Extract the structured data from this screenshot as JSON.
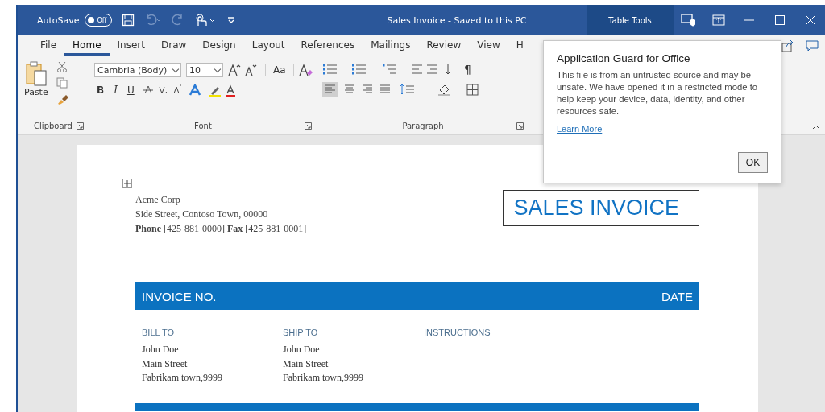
{
  "title_bar": {
    "autosave_label": "AutoSave",
    "autosave_toggle": {
      "label": "Off",
      "on": false
    },
    "title": "Sales Invoice  -  Saved to this PC",
    "context_tab": "Table Tools"
  },
  "tabs": [
    {
      "label": "File",
      "selected": false
    },
    {
      "label": "Home",
      "selected": true
    },
    {
      "label": "Insert",
      "selected": false
    },
    {
      "label": "Draw",
      "selected": false
    },
    {
      "label": "Design",
      "selected": false
    },
    {
      "label": "Layout",
      "selected": false
    },
    {
      "label": "References",
      "selected": false
    },
    {
      "label": "Mailings",
      "selected": false
    },
    {
      "label": "Review",
      "selected": false
    },
    {
      "label": "View",
      "selected": false
    },
    {
      "label": "H",
      "selected": false
    }
  ],
  "ribbon": {
    "clipboard": {
      "paste_label": "Paste",
      "group_label": "Clipboard"
    },
    "font": {
      "font_name": "Cambria (Body)",
      "font_size": "10",
      "change_case": "Aa",
      "format_buttons": [
        "B",
        "I",
        "U"
      ],
      "group_label": "Font"
    },
    "paragraph": {
      "pilcrow": "¶",
      "group_label": "Paragraph"
    }
  },
  "popup": {
    "title": "Application Guard for Office",
    "message": "This file is from an untrusted source and may be unsafe. We have opened it in a restricted mode to help keep your device, data, identity, and other resources safe.",
    "link": "Learn More",
    "button": "OK"
  },
  "document": {
    "company_lines": [
      "Acme Corp",
      "Side Street, Contoso Town, 00000",
      "**Phone** [425-881-0000] **Fax** [425-881-0001]"
    ],
    "invoice_title": "SALES INVOICE",
    "header_bar": {
      "left": "INVOICE NO.",
      "right": "DATE"
    },
    "columns": [
      {
        "heading": "BILL TO",
        "lines": [
          "John Doe",
          "Main Street",
          "Fabrikam town,9999"
        ]
      },
      {
        "heading": "SHIP TO",
        "lines": [
          "John Doe",
          "Main Street",
          "Fabrikam town,9999"
        ]
      },
      {
        "heading": "INSTRUCTIONS"
      }
    ]
  }
}
